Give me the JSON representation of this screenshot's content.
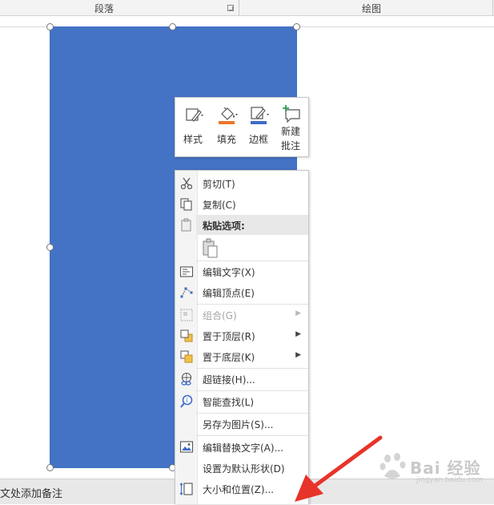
{
  "ribbon": {
    "group_paragraph": "段落",
    "group_drawing": "绘图"
  },
  "notes_bar": {
    "text": "文处添加备注"
  },
  "mini_toolbar": {
    "style": "样式",
    "fill": "填充",
    "outline": "边框",
    "new_comment_line1": "新建",
    "new_comment_line2": "批注",
    "colors": {
      "fill_bar": "#e8792b",
      "outline_bar": "#3d6cc9"
    }
  },
  "context_menu": {
    "cut": "剪切(T)",
    "copy": "复制(C)",
    "paste_options": "粘贴选项:",
    "edit_text": "编辑文字(X)",
    "edit_points": "编辑顶点(E)",
    "group": "组合(G)",
    "bring_to_front": "置于顶层(R)",
    "send_to_back": "置于底层(K)",
    "hyperlink": "超链接(H)...",
    "smart_lookup": "智能查找(L)",
    "save_as_picture": "另存为图片(S)...",
    "edit_alt_text": "编辑替换文字(A)...",
    "set_default_shape": "设置为默认形状(D)",
    "size_and_position": "大小和位置(Z)...",
    "submenu_arrow": "▶"
  },
  "shape": {
    "fill_color": "#4472c4"
  },
  "watermark": {
    "text": "Bai 经验",
    "sub": "jingyan.baidu.com"
  },
  "arrow_color": "#e8332a"
}
